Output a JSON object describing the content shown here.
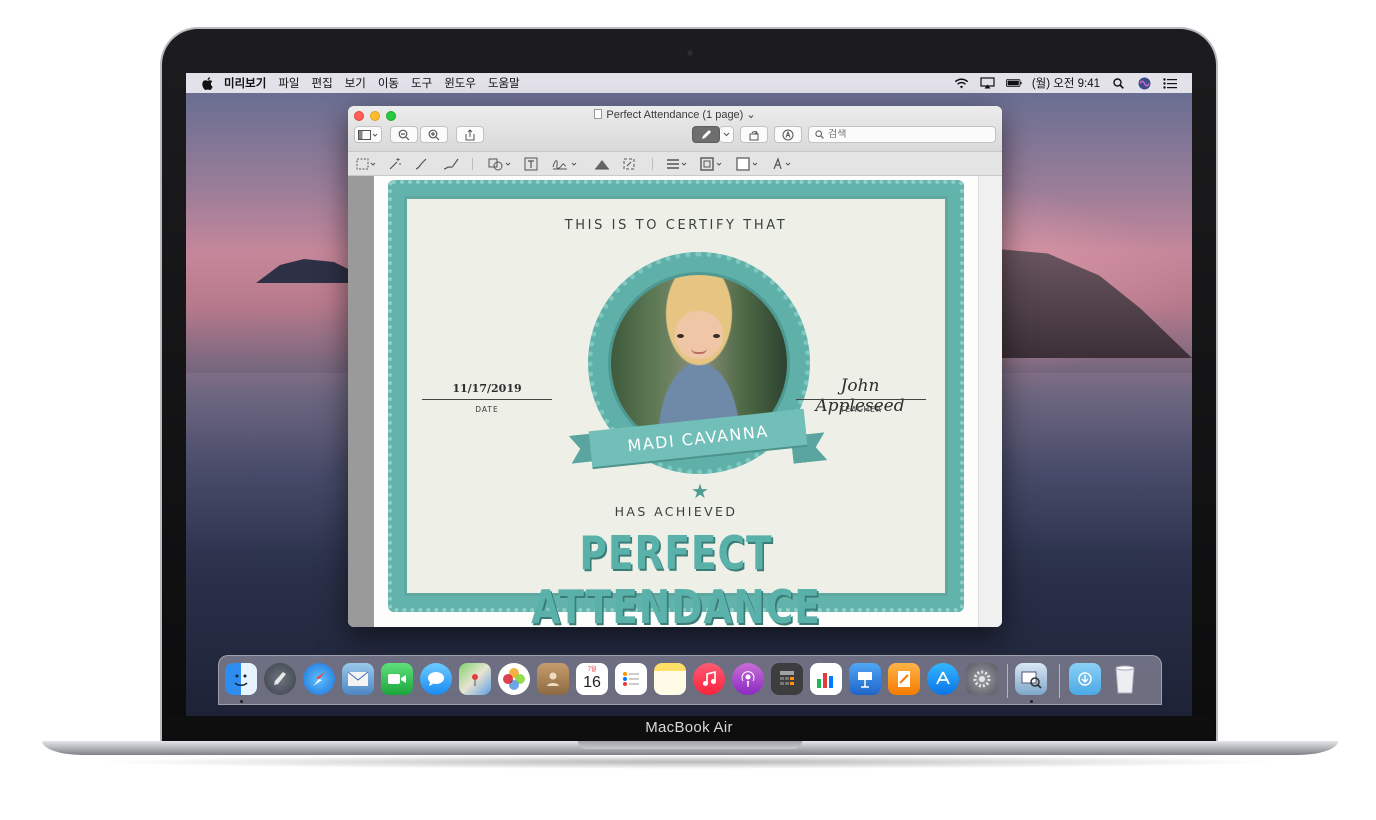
{
  "menubar": {
    "app_name": "미리보기",
    "items": [
      "파일",
      "편집",
      "보기",
      "이동",
      "도구",
      "윈도우",
      "도움말"
    ],
    "clock": "(월) 오전 9:41"
  },
  "window": {
    "title": "Perfect Attendance (1 page)",
    "search_placeholder": "검색"
  },
  "certificate": {
    "header": "THIS IS TO CERTIFY THAT",
    "student_name": "MADI CAVANNA",
    "has_achieved": "HAS ACHIEVED",
    "award": "PERFECT ATTENDANCE",
    "date_value": "11/17/2019",
    "date_caption": "DATE",
    "teacher_value": "John Appleseed",
    "teacher_caption": "TEACHER"
  },
  "dock": {
    "apps": [
      "finder-icon",
      "launchpad-icon",
      "safari-icon",
      "mail-icon",
      "facetime-icon",
      "messages-icon",
      "maps-icon",
      "photos-icon",
      "contacts-icon",
      "calendar-icon",
      "reminders-icon",
      "notes-icon",
      "music-icon",
      "podcasts-icon",
      "calculator-icon",
      "numbers-icon",
      "keynote-icon",
      "pages-icon",
      "app-store-icon",
      "system-preferences-icon",
      "preview-icon",
      "downloads-folder-icon",
      "trash-icon"
    ],
    "calendar_month": "7월",
    "calendar_day": "16"
  },
  "device": {
    "model_label": "MacBook Air"
  },
  "colors": {
    "teal": "#63b3ad",
    "cert_bg": "#eef0e7",
    "close": "#ff5f57",
    "minimize": "#febc2e",
    "zoom": "#28c840"
  }
}
